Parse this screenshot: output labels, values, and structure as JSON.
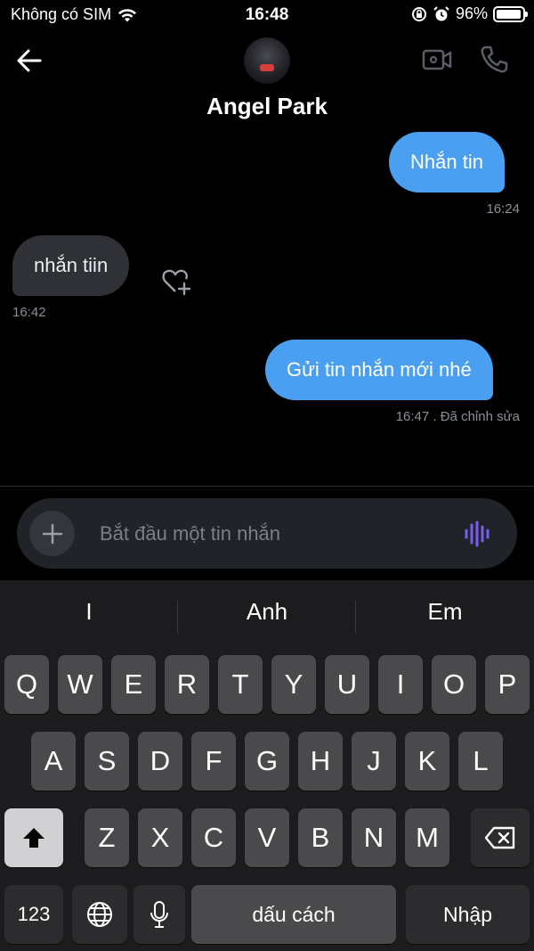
{
  "status_bar": {
    "carrier": "Không có SIM",
    "time": "16:48",
    "battery_percent": "96%",
    "battery_level": 0.96
  },
  "header": {
    "contact_name": "Angel Park",
    "icons": [
      "back-arrow-icon",
      "video-call-icon",
      "phone-call-icon"
    ]
  },
  "messages": [
    {
      "direction": "outgoing",
      "text": "Nhắn tin",
      "meta": "16:24"
    },
    {
      "direction": "incoming",
      "text": "nhắn tiin",
      "meta": "16:42"
    },
    {
      "direction": "outgoing",
      "text": "Gửi tin nhắn mới nhé",
      "meta": "16:47 . Đã chỉnh sửa"
    }
  ],
  "composer": {
    "placeholder": "Bắt đầu một tin nhắn",
    "value": ""
  },
  "keyboard": {
    "suggestions": [
      "I",
      "Anh",
      "Em"
    ],
    "row1": [
      "Q",
      "W",
      "E",
      "R",
      "T",
      "Y",
      "U",
      "I",
      "O",
      "P"
    ],
    "row2": [
      "A",
      "S",
      "D",
      "F",
      "G",
      "H",
      "J",
      "K",
      "L"
    ],
    "row3": [
      "Z",
      "X",
      "C",
      "V",
      "B",
      "N",
      "M"
    ],
    "numbers_label": "123",
    "space_label": "dấu cách",
    "return_label": "Nhập"
  },
  "colors": {
    "accent": "#4b9ff0",
    "incoming_bubble": "#2f3136",
    "voice_icon": "#7b5cf0"
  }
}
